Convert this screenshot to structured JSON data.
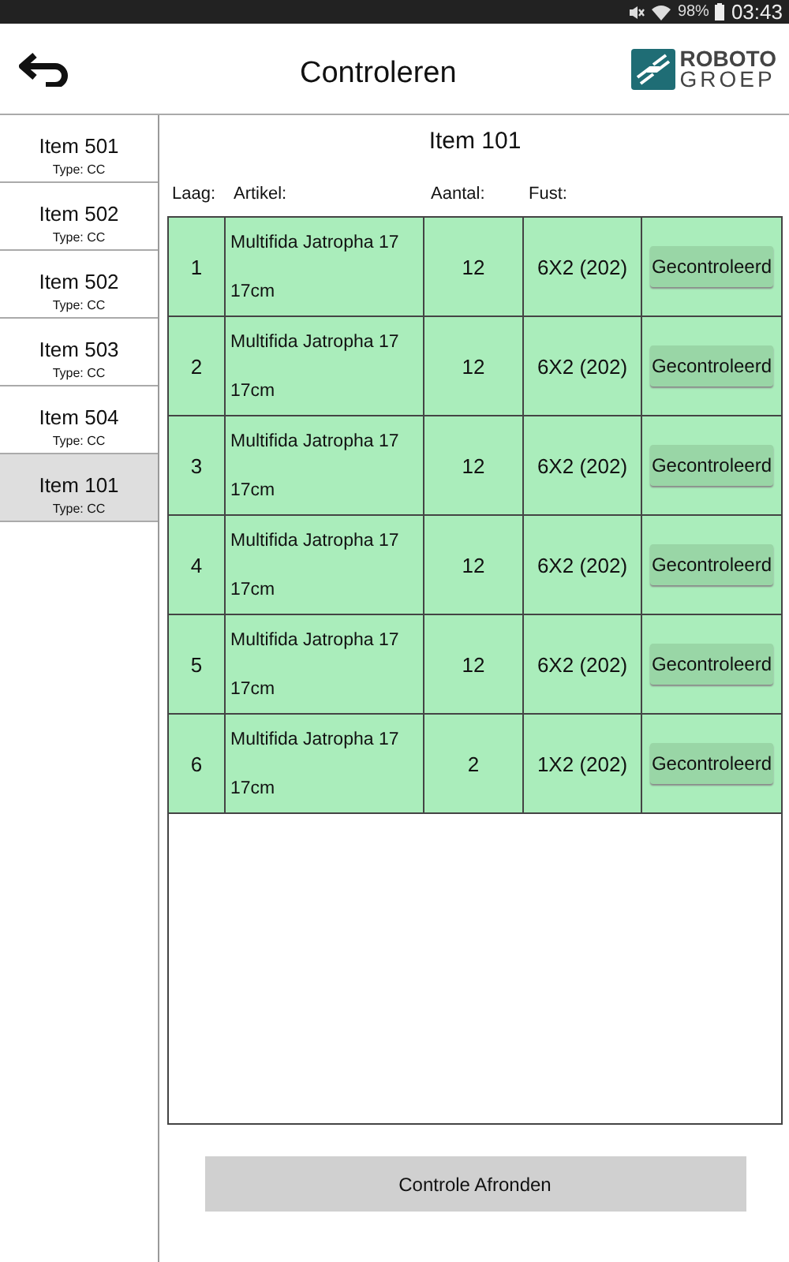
{
  "status_bar": {
    "battery": "98%",
    "time": "03:43"
  },
  "header": {
    "title": "Controleren",
    "logo": {
      "line_1": "ROBOTO",
      "line_2": "GROEP"
    }
  },
  "sidebar": {
    "items": [
      {
        "name": "Item 501",
        "type": "Type: CC",
        "selected": false
      },
      {
        "name": "Item 502",
        "type": "Type: CC",
        "selected": false
      },
      {
        "name": "Item 502",
        "type": "Type: CC",
        "selected": false
      },
      {
        "name": "Item 503",
        "type": "Type: CC",
        "selected": false
      },
      {
        "name": "Item 504",
        "type": "Type: CC",
        "selected": false
      },
      {
        "name": "Item 101",
        "type": "Type: CC",
        "selected": true
      }
    ]
  },
  "detail": {
    "title": "Item 101",
    "columns": [
      "Laag:",
      "Artikel:",
      "Aantal:",
      "Fust:"
    ],
    "rows": [
      {
        "laag": "1",
        "artikel": "Multifida Jatropha 17",
        "artikel_2": "17cm",
        "aantal": "12",
        "fust": "6X2 (202)",
        "button": "Gecontroleerd",
        "checked": true
      },
      {
        "laag": "2",
        "artikel": "Multifida Jatropha 17",
        "artikel_2": "17cm",
        "aantal": "12",
        "fust": "6X2 (202)",
        "button": "Gecontroleerd",
        "checked": true
      },
      {
        "laag": "3",
        "artikel": "Multifida Jatropha 17",
        "artikel_2": "17cm",
        "aantal": "12",
        "fust": "6X2 (202)",
        "button": "Gecontroleerd",
        "checked": true
      },
      {
        "laag": "4",
        "artikel": "Multifida Jatropha 17",
        "artikel_2": "17cm",
        "aantal": "12",
        "fust": "6X2 (202)",
        "button": "Gecontroleerd",
        "checked": true
      },
      {
        "laag": "5",
        "artikel": "Multifida Jatropha 17",
        "artikel_2": "17cm",
        "aantal": "12",
        "fust": "6X2 (202)",
        "button": "Gecontroleerd",
        "checked": true
      },
      {
        "laag": "6",
        "artikel": "Multifida Jatropha 17",
        "artikel_2": "17cm",
        "aantal": "2",
        "fust": "1X2 (202)",
        "button": "Gecontroleerd",
        "checked": true
      }
    ],
    "finish_button": "Controle Afronden"
  }
}
